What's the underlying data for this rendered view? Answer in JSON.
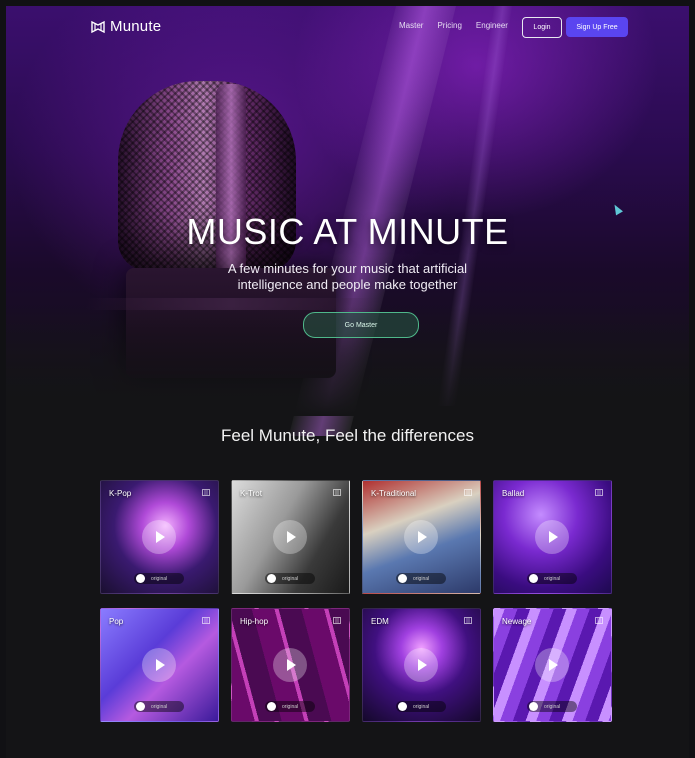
{
  "brand": {
    "name": "Munute"
  },
  "nav": {
    "links": [
      "Master",
      "Pricing",
      "Engineer"
    ],
    "login": "Login",
    "signup": "Sign Up Free"
  },
  "hero": {
    "title": "MUSIC AT MINUTE",
    "subtitle_line1": "A few minutes for your music that artificial",
    "subtitle_line2": "intelligence and people make together",
    "cta": "Go Master"
  },
  "section": {
    "title": "Feel Munute, Feel the differences"
  },
  "genres": [
    {
      "label": "K-Pop",
      "toggle": "original",
      "bg": "k-pop"
    },
    {
      "label": "K-Trot",
      "toggle": "original",
      "bg": "k-trot"
    },
    {
      "label": "K-Traditional",
      "toggle": "original",
      "bg": "k-traditional"
    },
    {
      "label": "Ballad",
      "toggle": "original",
      "bg": "ballad"
    },
    {
      "label": "Pop",
      "toggle": "original",
      "bg": "pop"
    },
    {
      "label": "Hip-hop",
      "toggle": "original",
      "bg": "hip-hop"
    },
    {
      "label": "EDM",
      "toggle": "original",
      "bg": "edm"
    },
    {
      "label": "Newage",
      "toggle": "original",
      "bg": "newage"
    }
  ],
  "colors": {
    "accent": "#5a45f0",
    "cta_border": "#4fb88a",
    "background": "#141416"
  },
  "icons": {
    "logo": "munute-logo-icon",
    "play": "play-icon",
    "card_corner": "bookmark-icon"
  }
}
